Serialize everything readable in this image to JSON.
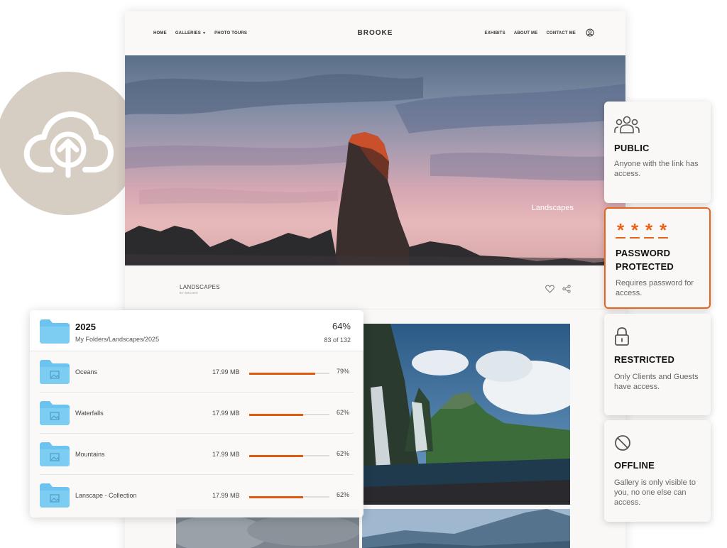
{
  "site": {
    "brand": "BROOKE",
    "nav_left": [
      "HOME",
      "GALLERIES",
      "PHOTO TOURS"
    ],
    "nav_right": [
      "EXHIBITS",
      "ABOUT ME",
      "CONTACT ME"
    ],
    "hero_caption": "Landscapes",
    "gallery_title": "LANDSCAPES",
    "gallery_byline": "BY BROOKE"
  },
  "folders": {
    "name": "2025",
    "path": "My Folders/Landscapes/2025",
    "percent": "64%",
    "count": "83 of 132",
    "items": [
      {
        "label": "Oceans",
        "size": "17.99 MB",
        "percent": "79%",
        "progress": 0.82
      },
      {
        "label": "Waterfalls",
        "size": "17.99 MB",
        "percent": "62%",
        "progress": 0.67
      },
      {
        "label": "Mountains",
        "size": "17.99 MB",
        "percent": "62%",
        "progress": 0.67
      },
      {
        "label": "Lanscape - Collection",
        "size": "17.99 MB",
        "percent": "62%",
        "progress": 0.67
      }
    ]
  },
  "access": {
    "public": {
      "title": "PUBLIC",
      "desc": "Anyone with the link has access."
    },
    "password": {
      "title": "PASSWORD PROTECTED",
      "desc": "Requires password for access.",
      "stars": "****"
    },
    "restricted": {
      "title": "RESTRICTED",
      "desc": "Only Clients and Guests have access."
    },
    "offline": {
      "title": "OFFLINE",
      "desc": "Gallery is only visible to you, no one else can access."
    }
  },
  "colors": {
    "accent": "#e8641b",
    "folder": "#6cc3f0",
    "upload_bg": "#d6cdc3"
  },
  "icons": [
    "upload-cloud-icon",
    "user-icon",
    "heart-icon",
    "share-icon",
    "folder-icon",
    "users-icon",
    "lock-icon",
    "ban-icon"
  ]
}
